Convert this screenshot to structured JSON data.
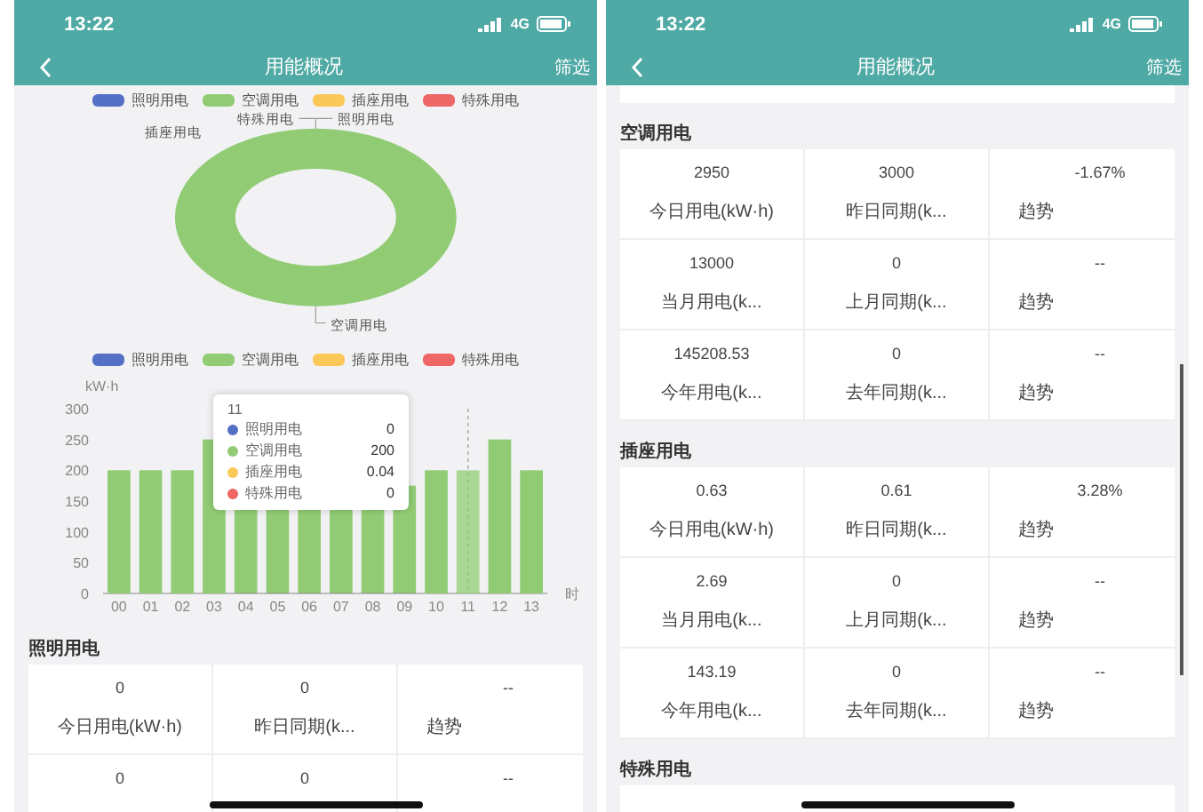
{
  "phones": [
    {
      "status_bar": {
        "time": "13:22",
        "network": "4G"
      },
      "nav_bar": {
        "title": "用能概况",
        "action": "筛选"
      },
      "blocks": [
        {
          "kind": "legend",
          "items": [
            {
              "label": "照明用电",
              "color": "#5470c6"
            },
            {
              "label": "空调用电",
              "color": "#91cc75"
            },
            {
              "label": "插座用电",
              "color": "#fac858"
            },
            {
              "label": "特殊用电",
              "color": "#ee6666"
            }
          ]
        },
        {
          "kind": "donut",
          "color": "#91cc75",
          "labels": [
            "特殊用电",
            "照明用电",
            "插座用电",
            "空调用电"
          ]
        },
        {
          "kind": "legend",
          "items": [
            {
              "label": "照明用电",
              "color": "#5470c6"
            },
            {
              "label": "空调用电",
              "color": "#91cc75"
            },
            {
              "label": "插座用电",
              "color": "#fac858"
            },
            {
              "label": "特殊用电",
              "color": "#ee6666"
            }
          ]
        },
        {
          "kind": "bars",
          "chart_data": {
            "type": "bar",
            "ylabel": "kW·h",
            "xlabel": "时",
            "categories": [
              "00",
              "01",
              "02",
              "03",
              "04",
              "05",
              "06",
              "07",
              "08",
              "09",
              "10",
              "11",
              "12",
              "13"
            ],
            "series": [
              {
                "color": "#91cc75",
                "values": [
                  200,
                  200,
                  200,
                  250,
                  null,
                  null,
                  null,
                  null,
                  null,
                  null,
                  200,
                  200,
                  250,
                  200
                ]
              }
            ],
            "ylim": [
              0,
              300
            ],
            "yticks": [
              0,
              50,
              100,
              150,
              200,
              250,
              300
            ]
          },
          "tooltip": {
            "title": "11",
            "rows": [
              {
                "name": "照明用电",
                "value": "0",
                "color": "#5470c6"
              },
              {
                "name": "空调用电",
                "value": "200",
                "color": "#91cc75"
              },
              {
                "name": "插座用电",
                "value": "0.04",
                "color": "#fac858"
              },
              {
                "name": "特殊用电",
                "value": "0",
                "color": "#ee6666"
              }
            ]
          }
        },
        {
          "kind": "section",
          "title": "照明用电",
          "rows": [
            [
              {
                "value": "0",
                "label": "今日用电(kW·h)"
              },
              {
                "value": "0",
                "label": "昨日同期(k..."
              },
              {
                "value": "--",
                "label": "趋势"
              }
            ],
            [
              {
                "value": "0"
              },
              {
                "value": "0"
              },
              {
                "value": "--"
              }
            ]
          ]
        }
      ]
    },
    {
      "status_bar": {
        "time": "13:22",
        "network": "4G"
      },
      "nav_bar": {
        "title": "用能概况",
        "action": "筛选"
      },
      "blocks": [
        {
          "kind": "cut_card"
        },
        {
          "kind": "section",
          "title": "空调用电",
          "rows": [
            [
              {
                "value": "2950",
                "label": "今日用电(kW·h)"
              },
              {
                "value": "3000",
                "label": "昨日同期(k..."
              },
              {
                "value": "-1.67%",
                "label": "趋势"
              }
            ],
            [
              {
                "value": "13000",
                "label": "当月用电(k..."
              },
              {
                "value": "0",
                "label": "上月同期(k..."
              },
              {
                "value": "--",
                "label": "趋势"
              }
            ],
            [
              {
                "value": "145208.53",
                "label": "今年用电(k..."
              },
              {
                "value": "0",
                "label": "去年同期(k..."
              },
              {
                "value": "--",
                "label": "趋势"
              }
            ]
          ]
        },
        {
          "kind": "section",
          "title": "插座用电",
          "rows": [
            [
              {
                "value": "0.63",
                "label": "今日用电(kW·h)"
              },
              {
                "value": "0.61",
                "label": "昨日同期(k..."
              },
              {
                "value": "3.28%",
                "label": "趋势"
              }
            ],
            [
              {
                "value": "2.69",
                "label": "当月用电(k..."
              },
              {
                "value": "0",
                "label": "上月同期(k..."
              },
              {
                "value": "--",
                "label": "趋势"
              }
            ],
            [
              {
                "value": "143.19",
                "label": "今年用电(k..."
              },
              {
                "value": "0",
                "label": "去年同期(k..."
              },
              {
                "value": "--",
                "label": "趋势"
              }
            ]
          ]
        },
        {
          "kind": "section",
          "title": "特殊用电"
        }
      ]
    }
  ]
}
